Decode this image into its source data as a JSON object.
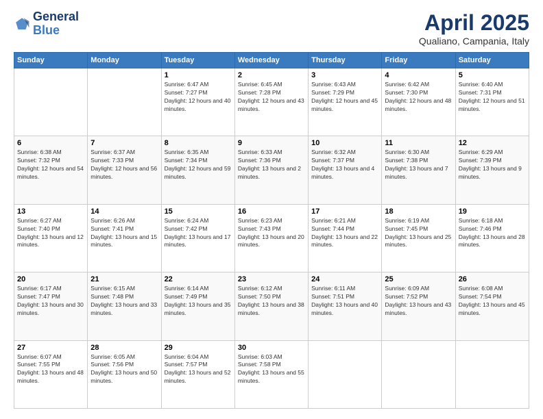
{
  "logo": {
    "text_general": "General",
    "text_blue": "Blue"
  },
  "header": {
    "title": "April 2025",
    "subtitle": "Qualiano, Campania, Italy"
  },
  "weekdays": [
    "Sunday",
    "Monday",
    "Tuesday",
    "Wednesday",
    "Thursday",
    "Friday",
    "Saturday"
  ],
  "weeks": [
    [
      null,
      null,
      {
        "day": 1,
        "sunrise": "6:47 AM",
        "sunset": "7:27 PM",
        "daylight": "12 hours and 40 minutes."
      },
      {
        "day": 2,
        "sunrise": "6:45 AM",
        "sunset": "7:28 PM",
        "daylight": "12 hours and 43 minutes."
      },
      {
        "day": 3,
        "sunrise": "6:43 AM",
        "sunset": "7:29 PM",
        "daylight": "12 hours and 45 minutes."
      },
      {
        "day": 4,
        "sunrise": "6:42 AM",
        "sunset": "7:30 PM",
        "daylight": "12 hours and 48 minutes."
      },
      {
        "day": 5,
        "sunrise": "6:40 AM",
        "sunset": "7:31 PM",
        "daylight": "12 hours and 51 minutes."
      }
    ],
    [
      {
        "day": 6,
        "sunrise": "6:38 AM",
        "sunset": "7:32 PM",
        "daylight": "12 hours and 54 minutes."
      },
      {
        "day": 7,
        "sunrise": "6:37 AM",
        "sunset": "7:33 PM",
        "daylight": "12 hours and 56 minutes."
      },
      {
        "day": 8,
        "sunrise": "6:35 AM",
        "sunset": "7:34 PM",
        "daylight": "12 hours and 59 minutes."
      },
      {
        "day": 9,
        "sunrise": "6:33 AM",
        "sunset": "7:36 PM",
        "daylight": "13 hours and 2 minutes."
      },
      {
        "day": 10,
        "sunrise": "6:32 AM",
        "sunset": "7:37 PM",
        "daylight": "13 hours and 4 minutes."
      },
      {
        "day": 11,
        "sunrise": "6:30 AM",
        "sunset": "7:38 PM",
        "daylight": "13 hours and 7 minutes."
      },
      {
        "day": 12,
        "sunrise": "6:29 AM",
        "sunset": "7:39 PM",
        "daylight": "13 hours and 9 minutes."
      }
    ],
    [
      {
        "day": 13,
        "sunrise": "6:27 AM",
        "sunset": "7:40 PM",
        "daylight": "13 hours and 12 minutes."
      },
      {
        "day": 14,
        "sunrise": "6:26 AM",
        "sunset": "7:41 PM",
        "daylight": "13 hours and 15 minutes."
      },
      {
        "day": 15,
        "sunrise": "6:24 AM",
        "sunset": "7:42 PM",
        "daylight": "13 hours and 17 minutes."
      },
      {
        "day": 16,
        "sunrise": "6:23 AM",
        "sunset": "7:43 PM",
        "daylight": "13 hours and 20 minutes."
      },
      {
        "day": 17,
        "sunrise": "6:21 AM",
        "sunset": "7:44 PM",
        "daylight": "13 hours and 22 minutes."
      },
      {
        "day": 18,
        "sunrise": "6:19 AM",
        "sunset": "7:45 PM",
        "daylight": "13 hours and 25 minutes."
      },
      {
        "day": 19,
        "sunrise": "6:18 AM",
        "sunset": "7:46 PM",
        "daylight": "13 hours and 28 minutes."
      }
    ],
    [
      {
        "day": 20,
        "sunrise": "6:17 AM",
        "sunset": "7:47 PM",
        "daylight": "13 hours and 30 minutes."
      },
      {
        "day": 21,
        "sunrise": "6:15 AM",
        "sunset": "7:48 PM",
        "daylight": "13 hours and 33 minutes."
      },
      {
        "day": 22,
        "sunrise": "6:14 AM",
        "sunset": "7:49 PM",
        "daylight": "13 hours and 35 minutes."
      },
      {
        "day": 23,
        "sunrise": "6:12 AM",
        "sunset": "7:50 PM",
        "daylight": "13 hours and 38 minutes."
      },
      {
        "day": 24,
        "sunrise": "6:11 AM",
        "sunset": "7:51 PM",
        "daylight": "13 hours and 40 minutes."
      },
      {
        "day": 25,
        "sunrise": "6:09 AM",
        "sunset": "7:52 PM",
        "daylight": "13 hours and 43 minutes."
      },
      {
        "day": 26,
        "sunrise": "6:08 AM",
        "sunset": "7:54 PM",
        "daylight": "13 hours and 45 minutes."
      }
    ],
    [
      {
        "day": 27,
        "sunrise": "6:07 AM",
        "sunset": "7:55 PM",
        "daylight": "13 hours and 48 minutes."
      },
      {
        "day": 28,
        "sunrise": "6:05 AM",
        "sunset": "7:56 PM",
        "daylight": "13 hours and 50 minutes."
      },
      {
        "day": 29,
        "sunrise": "6:04 AM",
        "sunset": "7:57 PM",
        "daylight": "13 hours and 52 minutes."
      },
      {
        "day": 30,
        "sunrise": "6:03 AM",
        "sunset": "7:58 PM",
        "daylight": "13 hours and 55 minutes."
      },
      null,
      null,
      null
    ]
  ]
}
